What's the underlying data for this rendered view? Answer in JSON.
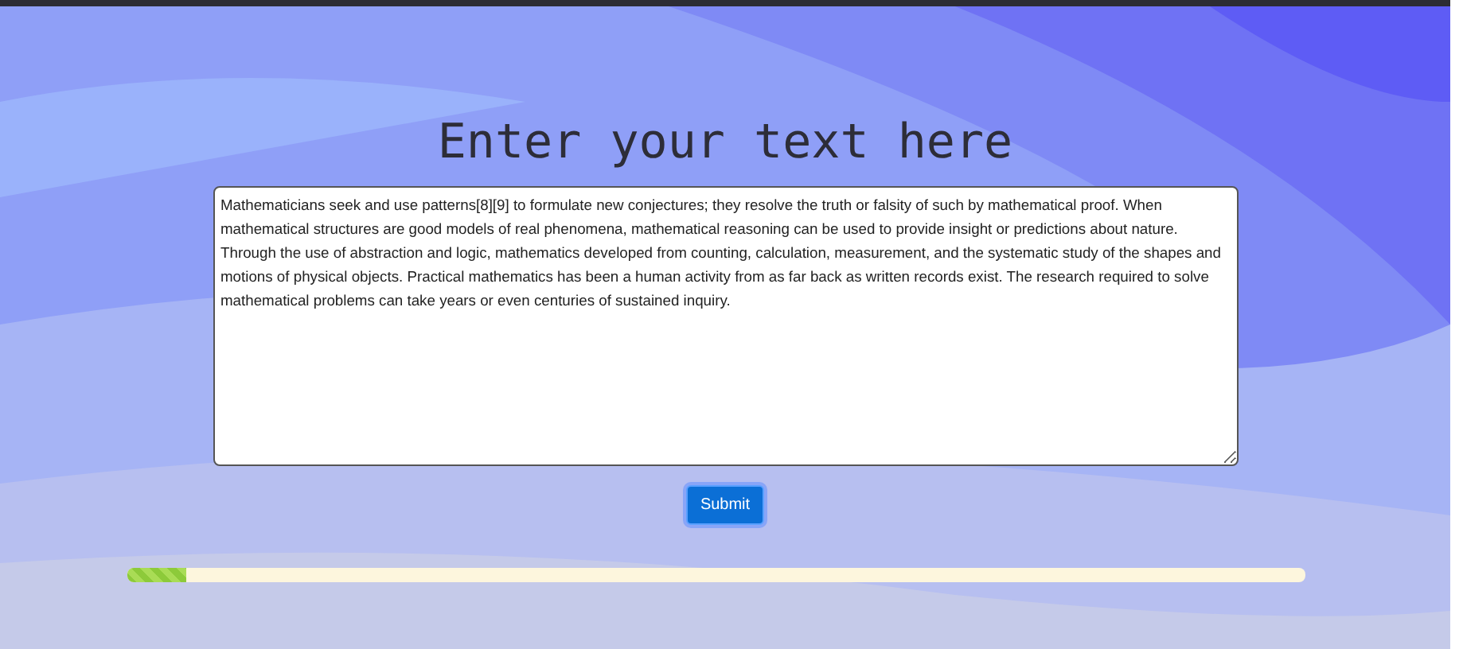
{
  "heading": "Enter your text here",
  "text_input": {
    "value": "Mathematicians seek and use patterns[8][9] to formulate new conjectures; they resolve the truth or falsity of such by mathematical proof. When mathematical structures are good models of real phenomena, mathematical reasoning can be used to provide insight or predictions about nature. Through the use of abstraction and logic, mathematics developed from counting, calculation, measurement, and the systematic study of the shapes and motions of physical objects. Practical mathematics has been a human activity from as far back as written records exist. The research required to solve mathematical problems can take years or even centuries of sustained inquiry."
  },
  "submit_button": {
    "label": "Submit"
  },
  "progress": {
    "level": 0.05
  }
}
